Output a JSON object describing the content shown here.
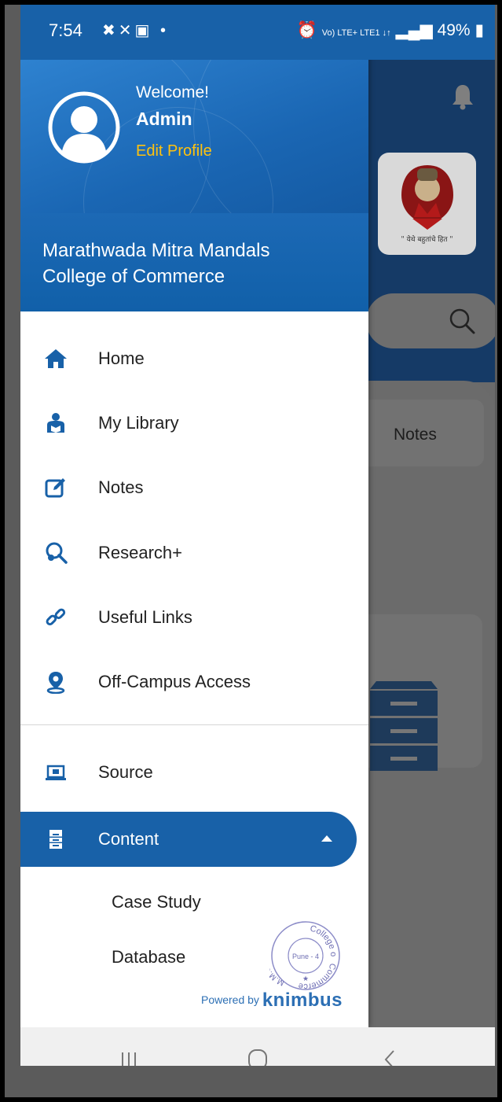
{
  "status_bar": {
    "time": "7:54",
    "left_icons": "✖✕▣ •",
    "network": "Vo) LTE+ LTE1 ↓↑",
    "battery": "49%"
  },
  "background": {
    "notes_label": "Notes",
    "logo_motto": "\" येथे बहुतांचे हित \""
  },
  "drawer": {
    "welcome": "Welcome!",
    "user_name": "Admin",
    "edit_profile": "Edit Profile",
    "college_line1": "Marathwada Mitra Mandals",
    "college_line2": "College of Commerce",
    "menu": [
      {
        "label": "Home",
        "icon": "home-icon"
      },
      {
        "label": "My Library",
        "icon": "library-icon"
      },
      {
        "label": "Notes",
        "icon": "edit-note-icon"
      },
      {
        "label": "Research+",
        "icon": "research-icon"
      },
      {
        "label": "Useful Links",
        "icon": "link-icon"
      },
      {
        "label": "Off-Campus Access",
        "icon": "location-pin-icon"
      }
    ],
    "source": "Source",
    "content": "Content",
    "sub_items": [
      "Case Study",
      "Database"
    ],
    "stamp_top": "College of",
    "stamp_bottom": "Commerce",
    "stamp_center": "Pune - 4",
    "stamp_left": "M.M.C.C.",
    "powered_by": "Powered by",
    "brand": "knimbus"
  },
  "colors": {
    "primary": "#1861a8",
    "accent": "#ffc20e"
  }
}
